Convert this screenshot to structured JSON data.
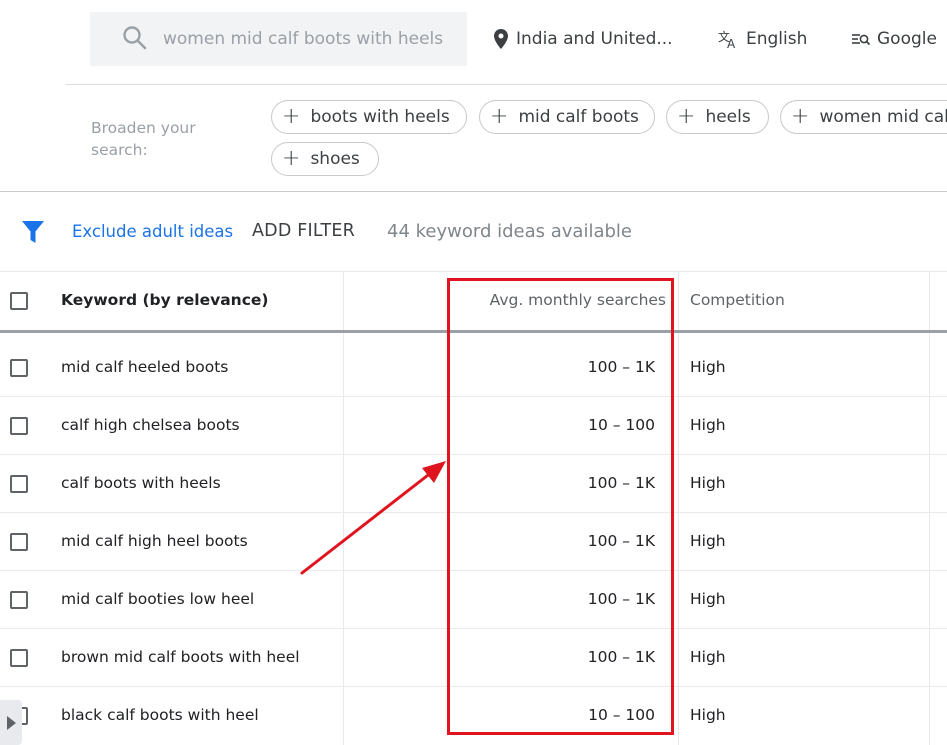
{
  "search": {
    "placeholder": "women mid calf boots with heels",
    "value": "women mid calf boots with heels"
  },
  "topbar": {
    "location": "India and United...",
    "language": "English",
    "network": "Google"
  },
  "broaden": {
    "label": "Broaden your search:",
    "chips": [
      "boots with heels",
      "mid calf boots",
      "heels",
      "women mid calf",
      "shoes"
    ]
  },
  "filter": {
    "exclude_label": "Exclude adult ideas",
    "add_filter_label": "ADD FILTER",
    "ideas_count": "44 keyword ideas available"
  },
  "table": {
    "columns": {
      "keyword": "Keyword (by relevance)",
      "avg_searches": "Avg. monthly searches",
      "competition": "Competition"
    },
    "rows": [
      {
        "keyword": "mid calf heeled boots",
        "avg": "100 – 1K",
        "competition": "High"
      },
      {
        "keyword": "calf high chelsea boots",
        "avg": "10 – 100",
        "competition": "High"
      },
      {
        "keyword": "calf boots with heels",
        "avg": "100 – 1K",
        "competition": "High"
      },
      {
        "keyword": "mid calf high heel boots",
        "avg": "100 – 1K",
        "competition": "High"
      },
      {
        "keyword": "mid calf booties low heel",
        "avg": "100 – 1K",
        "competition": "High"
      },
      {
        "keyword": "brown mid calf boots with heel",
        "avg": "100 – 1K",
        "competition": "High"
      },
      {
        "keyword": "black calf boots with heel",
        "avg": "10 – 100",
        "competition": "High"
      }
    ]
  },
  "colors": {
    "accent_blue": "#1a73e8",
    "annotation_red": "#e0141e",
    "search_bg": "#f1f3f4"
  }
}
